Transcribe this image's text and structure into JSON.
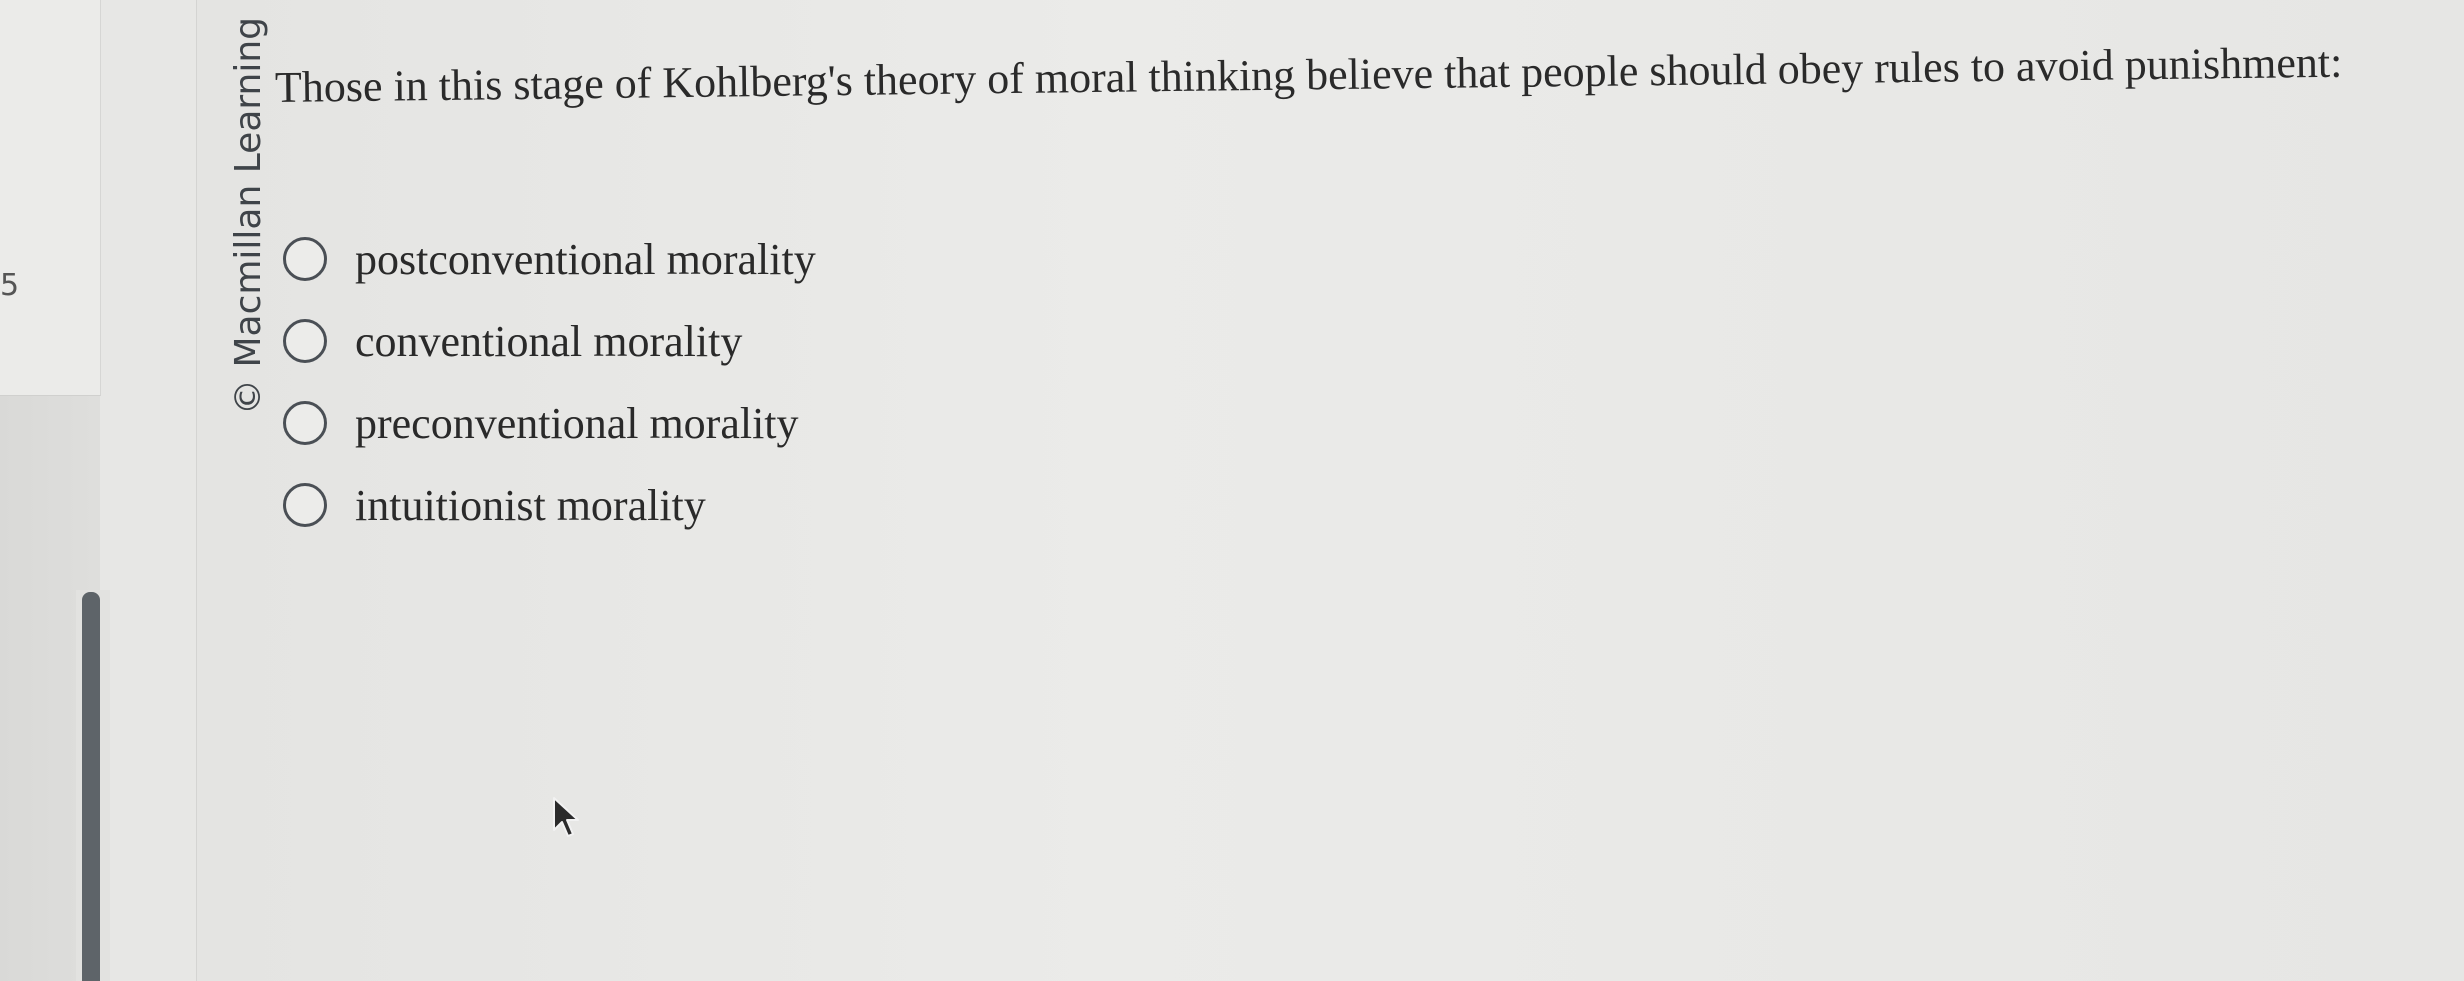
{
  "sidebar": {
    "question_number": "5"
  },
  "content": {
    "copyright": "© Macmillan Learning",
    "question": "Those in this stage of Kohlberg's theory of moral thinking believe that people should obey rules to avoid punishment:",
    "options": [
      {
        "label": "postconventional morality",
        "selected": false
      },
      {
        "label": "conventional morality",
        "selected": false
      },
      {
        "label": "preconventional morality",
        "selected": false
      },
      {
        "label": "intuitionist morality",
        "selected": false
      }
    ]
  },
  "icons": {
    "cursor": "mouse-pointer-icon",
    "radio": "radio-circle-icon"
  },
  "colors": {
    "background": "#e8e8e6",
    "text": "#2a2a2a",
    "radio_border": "#4a4f55",
    "scrollbar": "#5e6469"
  }
}
